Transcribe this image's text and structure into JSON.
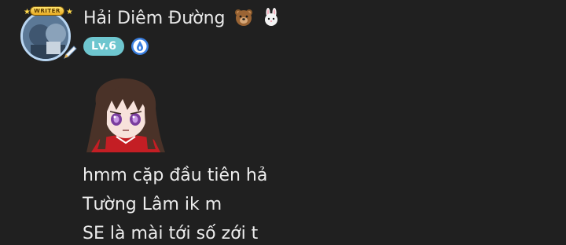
{
  "user": {
    "name": "Hải Diêm Đường",
    "badge_label": "WRITER",
    "level": "Lv.6",
    "emojis": [
      "bear-face-icon",
      "rabbit-face-icon"
    ],
    "verified_icon": "verified-drop-icon"
  },
  "post": {
    "sticker": "anime-girl-sticker",
    "lines": [
      "hmm cặp đầu tiên hả",
      "Tường Lâm ik m",
      "SE là mài tới số zới t"
    ]
  },
  "colors": {
    "background": "#202020",
    "level_badge": "#6ec6cf",
    "text": "#ececec",
    "verify": "#3a7fe0"
  }
}
